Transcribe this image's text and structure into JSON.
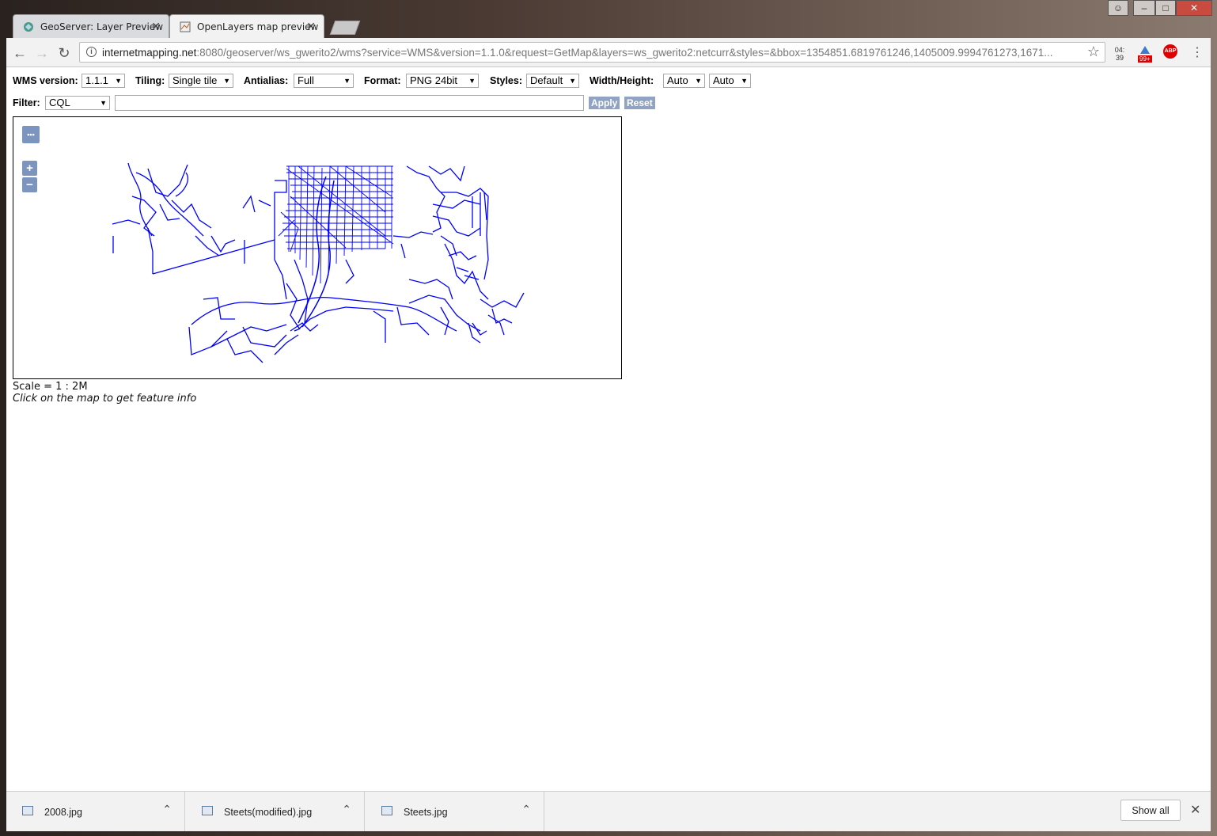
{
  "browser": {
    "tabs": [
      {
        "label": "GeoServer: Layer Preview",
        "active": false
      },
      {
        "label": "OpenLayers map preview",
        "active": true
      }
    ],
    "close_glyph": "✕",
    "url_host": "internetmapping.net",
    "url_rest": ":8080/geoserver/ws_gwerito2/wms?service=WMS&version=1.1.0&request=GetMap&layers=ws_gwerito2:netcurr&styles=&bbox=1354851.6819761246,1405009.9994761273,1671...",
    "clock_badge_top": "04:",
    "clock_badge_bottom": "39",
    "ext_badge": "99+",
    "abp_label": "ABP"
  },
  "controls": {
    "wms_version_label": "WMS version:",
    "wms_version_value": "1.1.1",
    "tiling_label": "Tiling:",
    "tiling_value": "Single tile",
    "antialias_label": "Antialias:",
    "antialias_value": "Full",
    "format_label": "Format:",
    "format_value": "PNG 24bit",
    "styles_label": "Styles:",
    "styles_value": "Default",
    "wh_label": "Width/Height:",
    "width_value": "Auto",
    "height_value": "Auto",
    "filter_label": "Filter:",
    "filter_type_value": "CQL",
    "filter_text_value": "",
    "apply_label": "Apply",
    "reset_label": "Reset"
  },
  "map": {
    "menu_glyph": "•••",
    "zoom_in_label": "+",
    "zoom_out_label": "−",
    "line_color": "#0000ff",
    "scale_text": "Scale = 1 : 2M",
    "hint_text": "Click on the map to get feature info"
  },
  "downloads": {
    "items": [
      {
        "name": "2008.jpg"
      },
      {
        "name": "Steets(modified).jpg"
      },
      {
        "name": "Steets.jpg"
      }
    ],
    "show_all_label": "Show all"
  }
}
